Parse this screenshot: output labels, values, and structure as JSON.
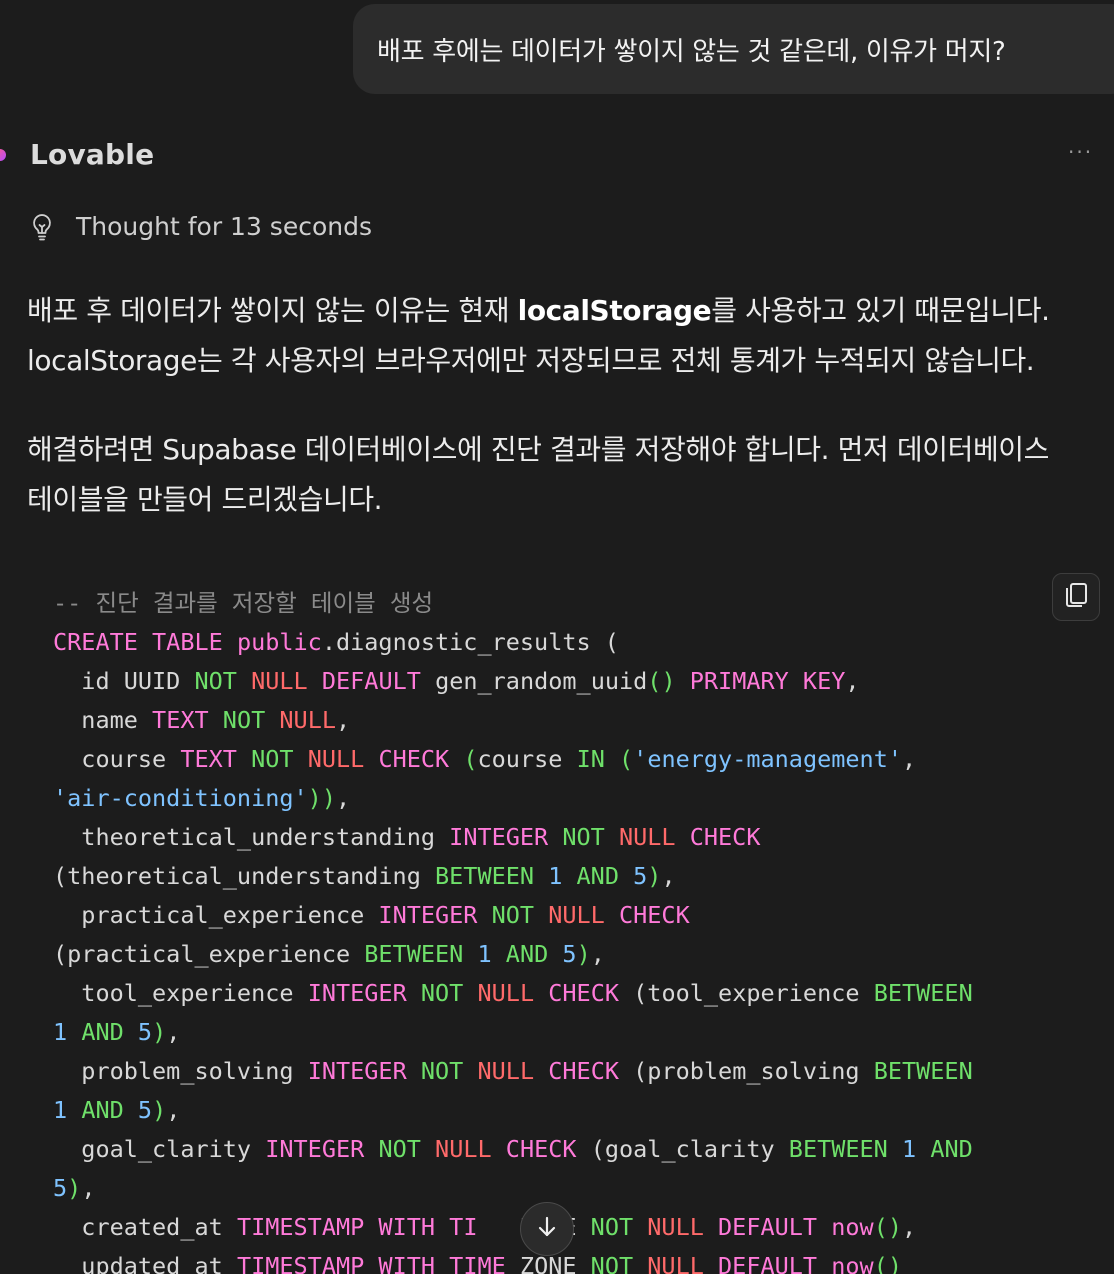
{
  "user_message": {
    "text": "배포 후에는 데이터가 쌓이지 않는 것 같은데, 이유가 머지?"
  },
  "assistant": {
    "name": "Lovable",
    "more_icon": "ellipsis-icon",
    "thought_icon": "lightbulb-icon",
    "thought_text": "Thought for 13 seconds",
    "paragraph1": {
      "line1_before": "배포 후 데이터가 쌓이지 않는 이유는 현재 ",
      "line1_bold": "localStorage",
      "line1_after": "를 사용하고 있기 때문입니다.",
      "line2": "localStorage는 각 사용자의 브라우저에만 저장되므로 전체 통계가 누적되지 않습니다."
    },
    "paragraph2": {
      "line1": "해결하려면 Supabase 데이터베이스에 진단 결과를 저장해야 합니다. 먼저 데이터베이스",
      "line2": "테이블을 만들어 드리겠습니다."
    }
  },
  "code_block": {
    "copy_icon": "copy-icon",
    "comment": "-- 진단 결과를 저장할 테이블 생성",
    "kw_create_table": "CREATE TABLE",
    "schema": "public",
    "table_name": ".diagnostic_results",
    "open_paren": " (",
    "col_id": "  id UUID",
    "col_name": "  name",
    "col_course": "  course",
    "course_in": "course",
    "val_energy": "'energy-management'",
    "val_air": "'air-conditioning'",
    "col_theoretical": "  theoretical_understanding",
    "paren_theoretical": "(theoretical_understanding",
    "col_practical": "  practical_experience",
    "paren_practical": "(practical_experience",
    "col_tool": "  tool_experience",
    "paren_tool": "(tool_experience",
    "col_problem": "  problem_solving",
    "paren_problem": "(problem_solving",
    "col_goal": "  goal_clarity",
    "paren_goal": "(goal_clarity",
    "col_created": "  created_at",
    "col_updated": "  updated_at",
    "k_not": "NOT",
    "k_null": "NULL",
    "k_default": "DEFAULT",
    "k_primary_key": "PRIMARY KEY",
    "k_text": "TEXT",
    "k_integer": "INTEGER",
    "k_check": "CHECK",
    "k_in": "IN",
    "k_between": "BETWEEN",
    "k_and": "AND",
    "k_timestamp_with": "TIMESTAMP WITH",
    "k_time": "TIME",
    "k_zone": "ZONE",
    "k_ti": "TI",
    "fn_uuid": "gen_random_uuid",
    "fn_now": "now",
    "num_1": "1",
    "num_5": "5"
  },
  "scroll_button": {
    "icon": "arrow-down-icon"
  }
}
